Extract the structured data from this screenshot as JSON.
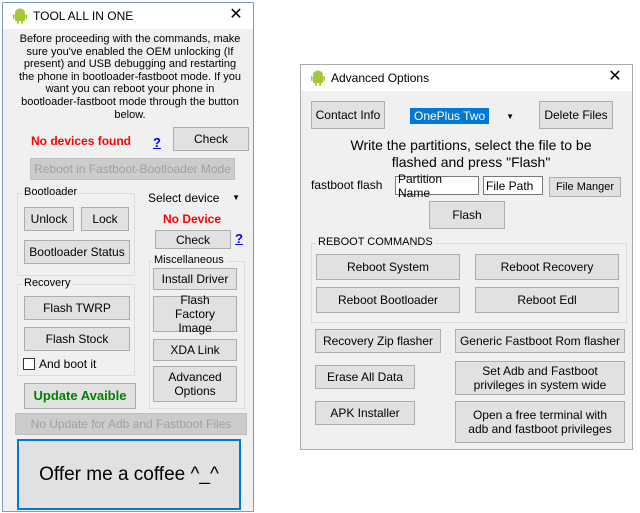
{
  "win1": {
    "title": "TOOL ALL IN ONE",
    "instructions": "Before proceeding with the commands, make sure you've enabled the OEM unlocking (If present) and USB debugging and restarting the phone in bootloader-fastboot mode. If you want you can reboot your phone in bootloader-fastboot mode through the button below.",
    "no_devices": "No devices found",
    "help_mark": "?",
    "check_label": "Check",
    "reboot_fastboot_label": "Reboot in Fastboot-Bootloader Mode",
    "bootloader_group": "Bootloader",
    "unlock_label": "Unlock",
    "lock_label": "Lock",
    "bootloader_status_label": "Bootloader Status",
    "select_device": "Select device",
    "no_device": "No Device",
    "check2_label": "Check",
    "recovery_group": "Recovery",
    "flash_twrp_label": "Flash TWRP",
    "flash_stock_label": "Flash Stock",
    "and_boot_it": "And boot it",
    "misc_group": "Miscellaneous",
    "install_driver_label": "Install Driver",
    "flash_factory_label": "Flash Factory Image",
    "xda_link_label": "XDA Link",
    "advanced_options_label": "Advanced Options",
    "update_label": "Update Avaible",
    "no_update_label": "No Update for Adb and Fastboot Files",
    "coffee_label": "Offer me a coffee  ^_^"
  },
  "win2": {
    "title": "Advanced Options",
    "contact_label": "Contact Info",
    "device_selected": "OnePlus Two",
    "delete_files_label": "Delete Files",
    "instruction": "Write the partitions, select the file to be flashed and press \"Flash\"",
    "fastboot_flash": "fastboot flash",
    "partition_name": "Partition Name",
    "file_path": "File Path",
    "file_manager_label": "File Manger",
    "flash_label": "Flash",
    "reboot_group": "REBOOT COMMANDS",
    "reboot_system": "Reboot System",
    "reboot_recovery": "Reboot Recovery",
    "reboot_bootloader": "Reboot Bootloader",
    "reboot_edl": "Reboot Edl",
    "recovery_zip": "Recovery Zip flasher",
    "generic_fastboot": "Generic Fastboot Rom flasher",
    "erase_all": "Erase All Data",
    "set_adb": "Set Adb and Fastboot privileges in system wide",
    "apk_installer": "APK Installer",
    "open_terminal": "Open a free terminal with adb and fastboot privileges"
  },
  "colors": {
    "error_red": "#ff0000",
    "update_green": "#008000",
    "help_blue": "#0000ff",
    "highlight_blue": "#0078d7",
    "window_border": "#7a9ccc",
    "android_green": "#a4c639"
  },
  "icons": {
    "title_icon": "android-icon",
    "close_icon": "close-icon",
    "dropdown_icon": "chevron-down-icon"
  }
}
